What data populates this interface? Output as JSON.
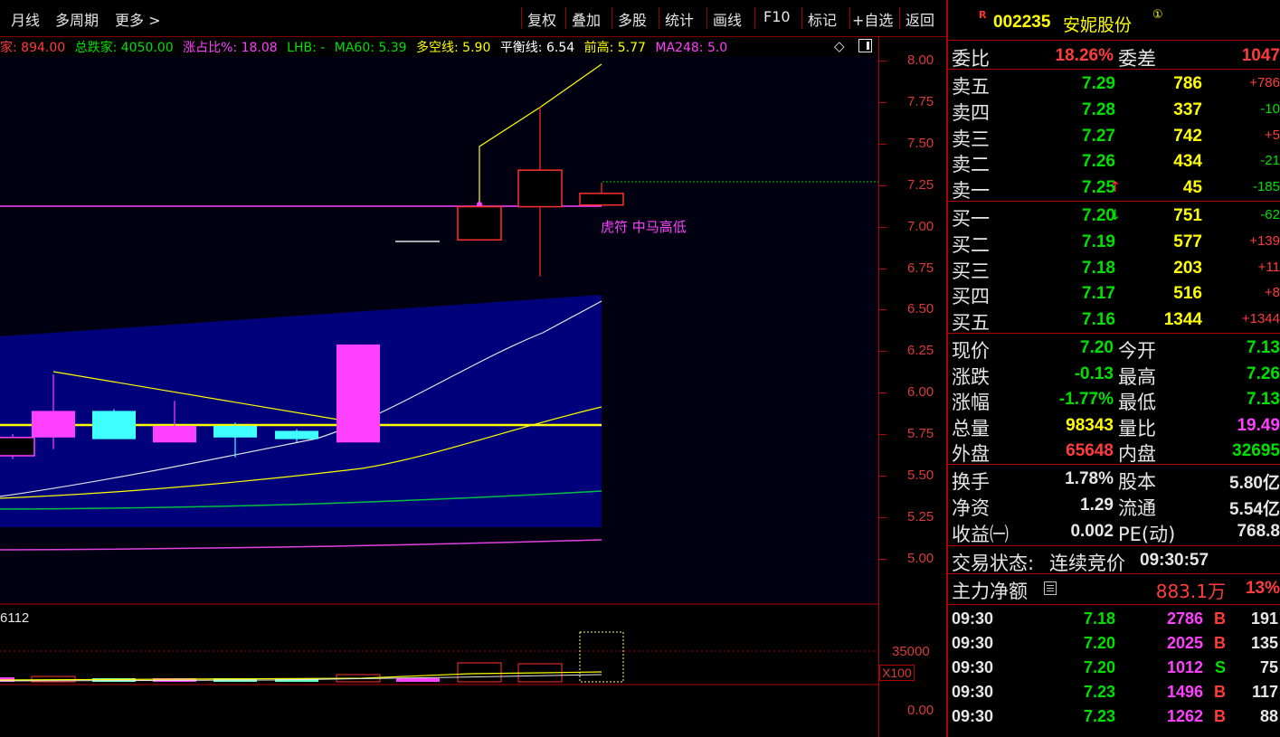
{
  "toolbar": {
    "left_items": [
      "月线",
      "多周期",
      "更多"
    ],
    "right_items": [
      "复权",
      "叠加",
      "多股",
      "统计",
      "画线",
      "F10",
      "标记",
      "+自选",
      "返回"
    ]
  },
  "infoline": [
    {
      "text": "家: 894.00",
      "color": "#ff3c3c"
    },
    {
      "text": "总跌家: 4050.00",
      "color": "#00e000"
    },
    {
      "text": "涨占比%: 18.08",
      "color": "#ff40ff"
    },
    {
      "text": "LHB: -",
      "color": "#00e000"
    },
    {
      "text": "MA60: 5.39",
      "color": "#00e000"
    },
    {
      "text": "多空线: 5.90",
      "color": "#ffff00"
    },
    {
      "text": "平衡线: 6.54",
      "color": "#ffffff"
    },
    {
      "text": "前高: 5.77",
      "color": "#ffff00"
    },
    {
      "text": "MA248: 5.0",
      "color": "#ff40ff"
    }
  ],
  "price_axis": {
    "ticks": [
      "8.00",
      "7.75",
      "7.50",
      "7.25",
      "7.00",
      "6.75",
      "6.50",
      "6.25",
      "6.00",
      "5.75",
      "5.50",
      "5.25",
      "5.00"
    ]
  },
  "volume_axis": {
    "top_label": "35000",
    "unit": "X100",
    "bottom_label": "0.00"
  },
  "volume_indicator_text": "6112",
  "chart_annotation": "虎符 中马高低",
  "candles": [
    {
      "open": 5.62,
      "close": 5.73,
      "high": 5.75,
      "low": 5.6,
      "color": "#ff40ff",
      "style": "outline"
    },
    {
      "open": 5.73,
      "close": 5.89,
      "high": 6.11,
      "low": 5.66,
      "color": "#ff40ff",
      "style": "filled"
    },
    {
      "open": 5.89,
      "close": 5.72,
      "high": 5.9,
      "low": 5.72,
      "color": "#40ffff",
      "style": "filled"
    },
    {
      "open": 5.7,
      "close": 5.8,
      "high": 5.95,
      "low": 5.7,
      "color": "#ff40ff",
      "style": "filled"
    },
    {
      "open": 5.8,
      "close": 5.73,
      "high": 5.82,
      "low": 5.61,
      "color": "#40ffff",
      "style": "filled"
    },
    {
      "open": 5.77,
      "close": 5.72,
      "high": 5.78,
      "low": 5.7,
      "color": "#40ffff",
      "style": "filled"
    },
    {
      "open": 5.7,
      "close": 6.29,
      "high": 6.29,
      "low": 5.7,
      "color": "#ff40ff",
      "style": "filled"
    },
    {
      "open": 6.92,
      "close": 7.12,
      "high": 7.12,
      "low": 6.92,
      "color": "#ff3030",
      "style": "outline"
    },
    {
      "open": 7.12,
      "close": 7.34,
      "high": 7.72,
      "low": 6.7,
      "color": "#ff3030",
      "style": "outline"
    },
    {
      "open": 7.13,
      "close": 7.2,
      "high": 7.26,
      "low": 7.13,
      "color": "#ff3030",
      "style": "outline"
    }
  ],
  "quote": {
    "code": "002235",
    "name": "安妮股份",
    "badge": "①",
    "r_mark": "R",
    "wei_bi_label": "委比",
    "wei_bi": "18.26%",
    "wei_cha_label": "委差",
    "wei_cha": "1047",
    "asks": [
      {
        "label": "卖五",
        "price": "7.29",
        "vol": "786",
        "chg": "+786"
      },
      {
        "label": "卖四",
        "price": "7.28",
        "vol": "337",
        "chg": "-10"
      },
      {
        "label": "卖三",
        "price": "7.27",
        "vol": "742",
        "chg": "+5"
      },
      {
        "label": "卖二",
        "price": "7.26",
        "vol": "434",
        "chg": "-21"
      },
      {
        "label": "卖一",
        "price": "7.25",
        "vol": "45",
        "chg": "-185",
        "arrow": "↑"
      }
    ],
    "bids": [
      {
        "label": "买一",
        "price": "7.20",
        "vol": "751",
        "chg": "-62",
        "arrow": "↓"
      },
      {
        "label": "买二",
        "price": "7.19",
        "vol": "577",
        "chg": "+139"
      },
      {
        "label": "买三",
        "price": "7.18",
        "vol": "203",
        "chg": "+11"
      },
      {
        "label": "买四",
        "price": "7.17",
        "vol": "516",
        "chg": "+8"
      },
      {
        "label": "买五",
        "price": "7.16",
        "vol": "1344",
        "chg": "+1344"
      }
    ],
    "stats1": [
      {
        "l1": "现价",
        "v1": "7.20",
        "c1": "#00e000",
        "l2": "今开",
        "v2": "7.13",
        "c2": "#00e000"
      },
      {
        "l1": "涨跌",
        "v1": "-0.13",
        "c1": "#00e000",
        "l2": "最高",
        "v2": "7.26",
        "c2": "#00e000"
      },
      {
        "l1": "涨幅",
        "v1": "-1.77%",
        "c1": "#00e000",
        "l2": "最低",
        "v2": "7.13",
        "c2": "#00e000"
      },
      {
        "l1": "总量",
        "v1": "98343",
        "c1": "#ffff00",
        "l2": "量比",
        "v2": "19.49",
        "c2": "#ff40ff"
      },
      {
        "l1": "外盘",
        "v1": "65648",
        "c1": "#ff3c3c",
        "l2": "内盘",
        "v2": "32695",
        "c2": "#00e000"
      }
    ],
    "stats2": [
      {
        "l1": "换手",
        "v1": "1.78%",
        "l2": "股本",
        "v2": "5.80亿"
      },
      {
        "l1": "净资",
        "v1": "1.29",
        "l2": "流通",
        "v2": "5.54亿"
      },
      {
        "l1": "收益㈠",
        "v1": "0.002",
        "l2": "PE(动)",
        "v2": "768.8"
      }
    ],
    "trade_status_label": "交易状态:",
    "trade_status": "连续竞价",
    "trade_time": "09:30:57",
    "main_force_label": "主力净额",
    "main_force_value": "883.1万",
    "main_force_pct": "13%",
    "ticks": [
      {
        "time": "09:30",
        "price": "7.18",
        "vol": "2786",
        "side": "B",
        "count": "191"
      },
      {
        "time": "09:30",
        "price": "7.20",
        "vol": "2025",
        "side": "B",
        "count": "135"
      },
      {
        "time": "09:30",
        "price": "7.20",
        "vol": "1012",
        "side": "S",
        "count": "75"
      },
      {
        "time": "09:30",
        "price": "7.23",
        "vol": "1496",
        "side": "B",
        "count": "117"
      },
      {
        "time": "09:30",
        "price": "7.23",
        "vol": "1262",
        "side": "B",
        "count": "88"
      }
    ]
  }
}
